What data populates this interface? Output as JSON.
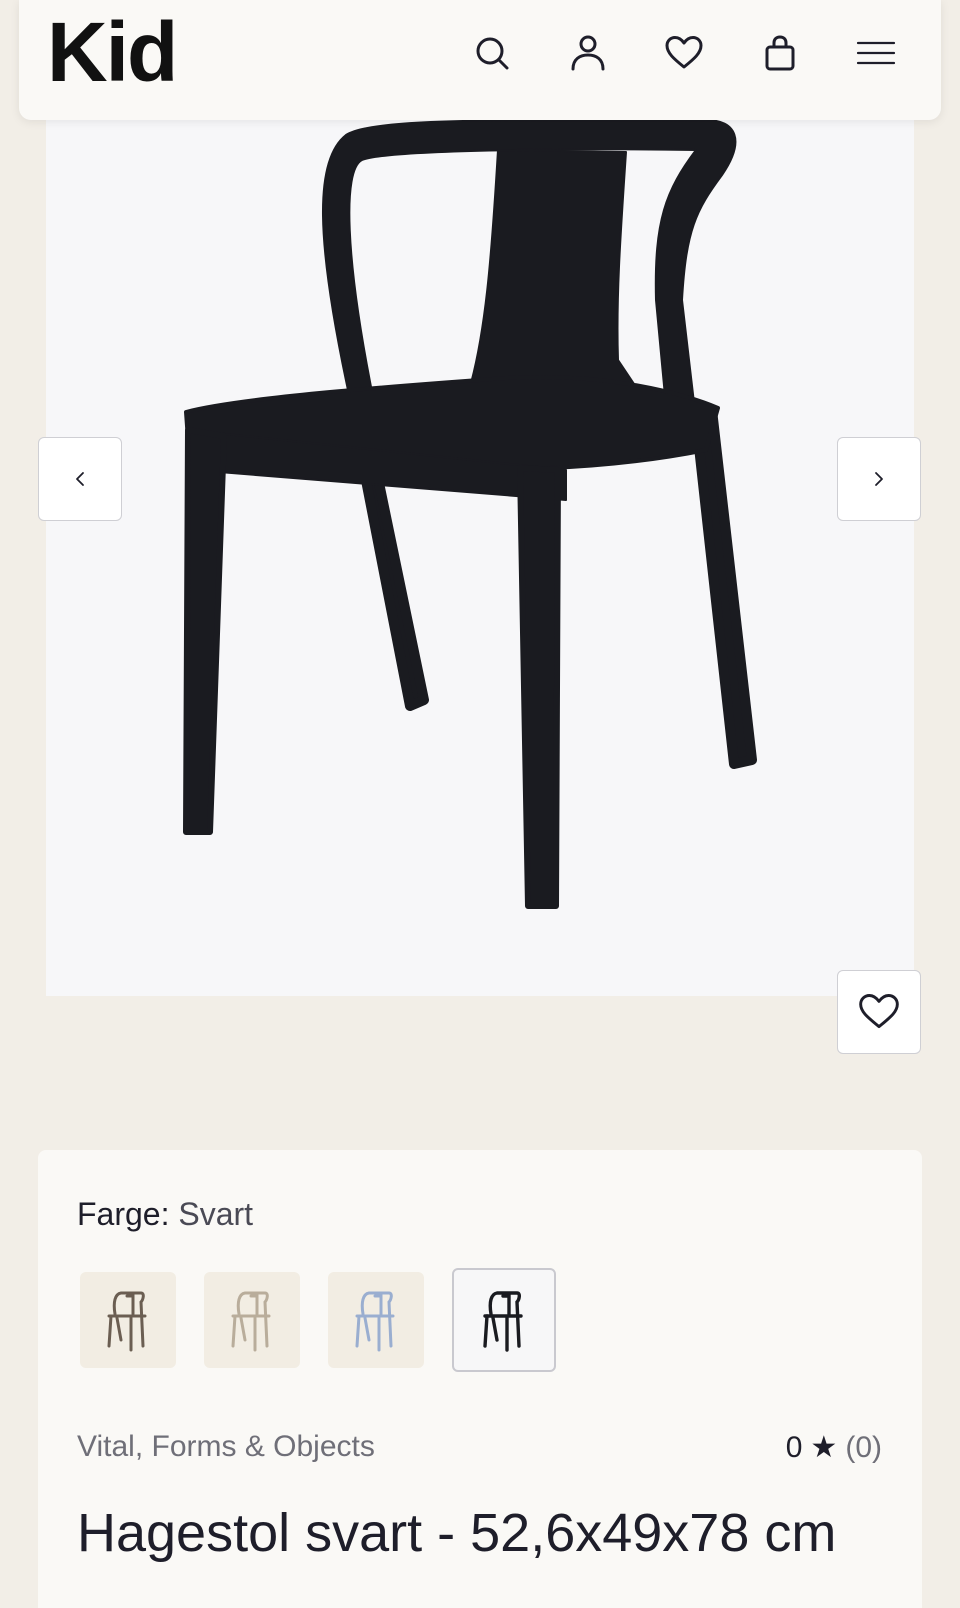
{
  "header": {
    "logo": "Kid",
    "icons": [
      "search-icon",
      "account-icon",
      "wishlist-icon",
      "cart-icon",
      "menu-icon"
    ]
  },
  "gallery": {
    "image_alt": "Hagestol svart",
    "prev_icon": "chevron-left-icon",
    "next_icon": "chevron-right-icon",
    "favorite_icon": "heart-icon"
  },
  "product": {
    "color_label": "Farge:",
    "color_value": "Svart",
    "swatches": [
      {
        "name": "brun",
        "color": "#6b5e52"
      },
      {
        "name": "beige",
        "color": "#cfc4b4"
      },
      {
        "name": "blå",
        "color": "#a8b7d3"
      },
      {
        "name": "svart",
        "color": "#1a1b20",
        "selected": true
      }
    ],
    "brand": "Vital, Forms & Objects",
    "rating_value": "0",
    "rating_star": "★",
    "rating_count": "(0)",
    "title": "Hagestol svart - 52,6x49x78 cm"
  },
  "colors": {
    "background": "#f2eee7",
    "panel": "#faf9f6",
    "chair": "#1a1b20",
    "text": "#1e1e2a",
    "muted": "#6f6f78"
  }
}
